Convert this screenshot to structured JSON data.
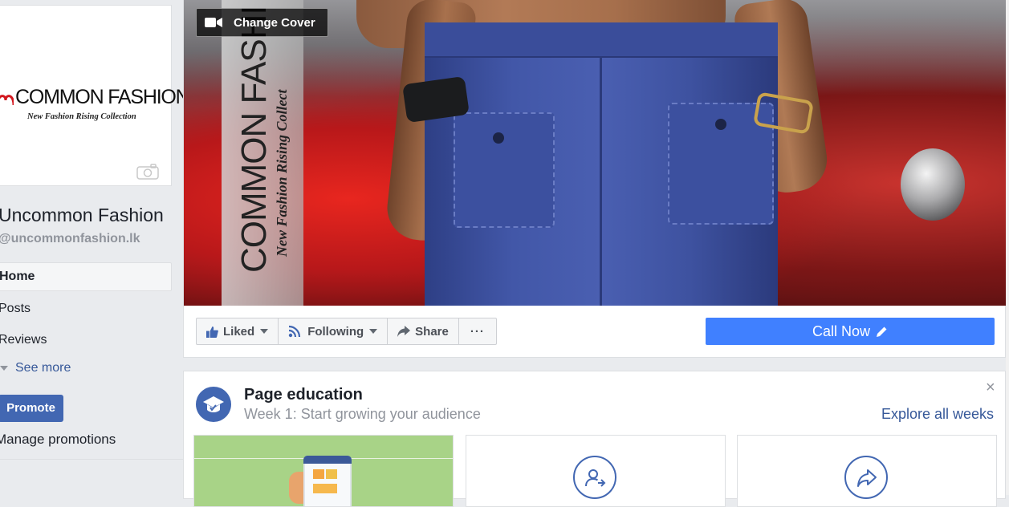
{
  "sidebar": {
    "logo": {
      "brand_text": "COMMON FASHION",
      "tagline": "New Fashion Rising Collection",
      "camera_icon": "camera-icon"
    },
    "page_name": "Uncommon Fashion",
    "page_handle": "@uncommonfashion.lk",
    "nav": {
      "home": "Home",
      "posts": "Posts",
      "reviews": "Reviews",
      "see_more": "See more"
    },
    "promote_label": "Promote",
    "manage_promotions": "Manage promotions"
  },
  "cover": {
    "change_cover_label": "Change Cover",
    "banner_text": "COMMON FASHI",
    "banner_sub": "New Fashion Rising Collect"
  },
  "actions": {
    "liked": "Liked",
    "following": "Following",
    "share": "Share",
    "more": "···",
    "call_now": "Call Now"
  },
  "page_education": {
    "title": "Page education",
    "subtitle": "Week 1: Start growing your audience",
    "explore": "Explore all weeks",
    "close": "×",
    "tiles": [
      {
        "icon": "phone-illustration"
      },
      {
        "icon": "add-person-icon"
      },
      {
        "icon": "share-arrow-icon"
      }
    ]
  },
  "colors": {
    "accent": "#4267b2",
    "call_now": "#4080ff",
    "link": "#365899",
    "page_bg": "#e9ebee"
  }
}
